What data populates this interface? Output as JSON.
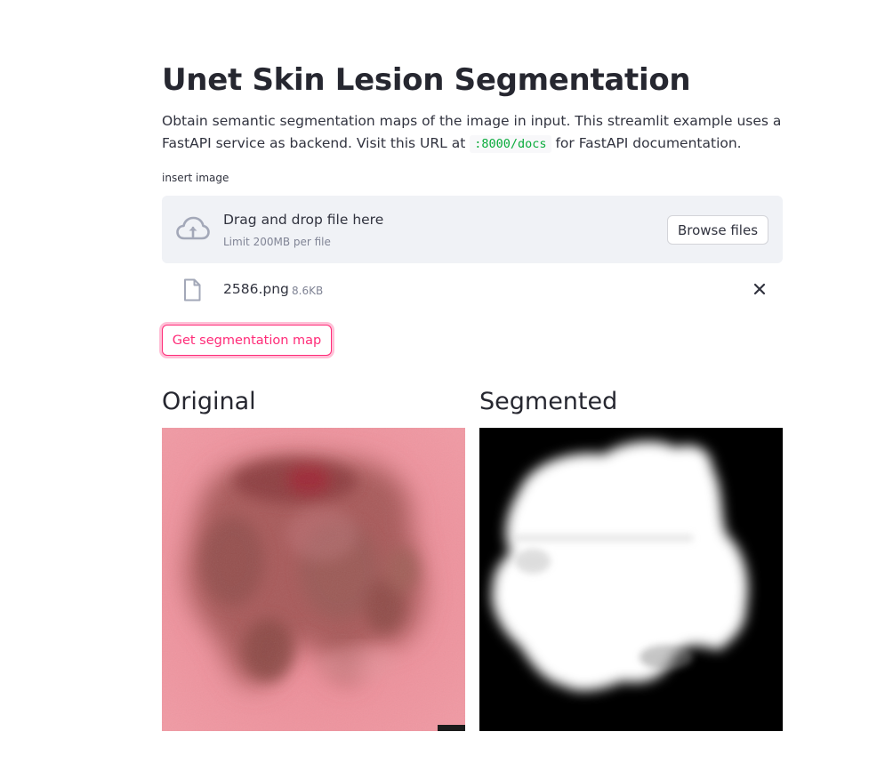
{
  "page": {
    "title": "Unet Skin Lesion Segmentation",
    "description": {
      "part1": "Obtain semantic segmentation maps of the image in input. This streamlit example uses a FastAPI service as backend. Visit this URL at",
      "code": ":8000/docs",
      "part2": "for FastAPI documentation."
    }
  },
  "uploader": {
    "label": "insert image",
    "drop_title": "Drag and drop file here",
    "limit": "Limit 200MB per file",
    "browse_label": "Browse files",
    "icon": "cloud-upload-icon"
  },
  "uploaded_file": {
    "name": "2586.png",
    "size": "8.6KB",
    "icon": "file-icon",
    "remove_icon": "close-icon"
  },
  "actions": {
    "segment_label": "Get segmentation map"
  },
  "results": {
    "original_title": "Original",
    "segmented_title": "Segmented"
  },
  "colors": {
    "accent": "#ff2b78",
    "code": "#09ab3b",
    "dropzone_bg": "#f0f2f6",
    "text": "#31333f",
    "muted": "#808495"
  }
}
